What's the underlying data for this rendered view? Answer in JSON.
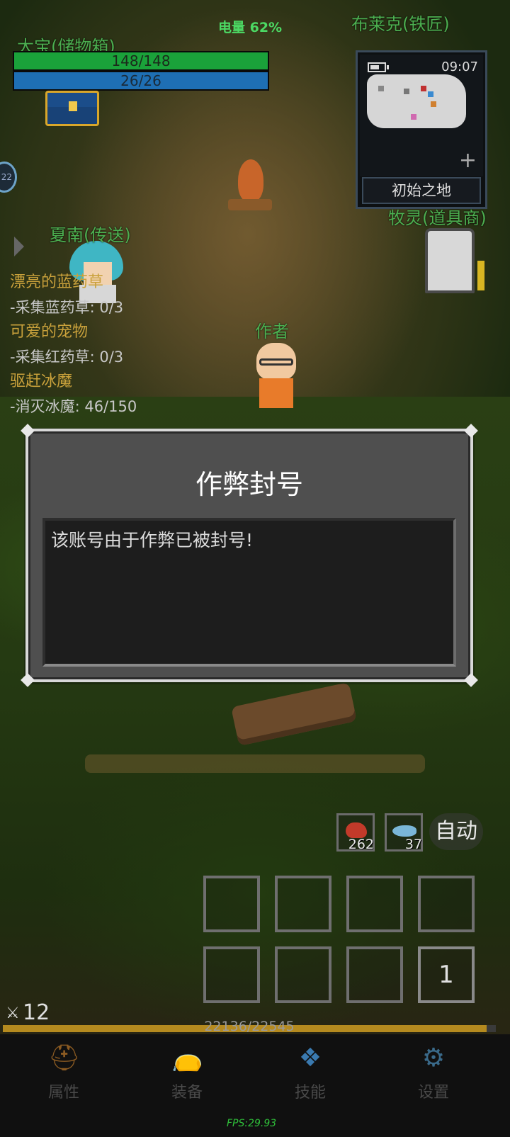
{
  "hud": {
    "battery_label": "电量 62%",
    "hp": "148/148",
    "mp": "26/26",
    "side_badge": "22"
  },
  "names": {
    "storage": "大宝(储物箱)",
    "blacksmith": "布莱克(铁匠)",
    "teleport": "夏南(传送)",
    "shop": "牧灵(道具商)",
    "player": "作者"
  },
  "minimap": {
    "time": "09:07",
    "region": "初始之地",
    "plus": "+"
  },
  "quests": [
    {
      "title": "漂亮的蓝药草",
      "task": "-采集蓝药草: 0/3"
    },
    {
      "title": "可爱的宠物",
      "task": "-采集红药草: 0/3"
    },
    {
      "title": "驱赶冰魔",
      "task": "-消灭冰魔: 46/150"
    }
  ],
  "dialog": {
    "title": "作弊封号",
    "message": "该账号由于作弊已被封号!"
  },
  "items": {
    "meat_count": "262",
    "fish_count": "37",
    "auto_label": "自动"
  },
  "skills": {
    "slot_number": "1"
  },
  "status": {
    "weapon_value": "12",
    "xp_text": "22136/22545",
    "xp_fraction": 0.982,
    "fps": "FPS:29.93"
  },
  "nav": [
    {
      "label": "属性",
      "icon": "helmet-icon"
    },
    {
      "label": "装备",
      "icon": "bag-icon"
    },
    {
      "label": "技能",
      "icon": "crystal-icon"
    },
    {
      "label": "设置",
      "icon": "gear-icon"
    }
  ],
  "colors": {
    "npc_name": "#4caf50",
    "quest_title": "#c9a13b",
    "hp_bar": "#1aa23a",
    "mp_bar": "#1e6fb4",
    "xp_bar": "#b58a1f"
  }
}
